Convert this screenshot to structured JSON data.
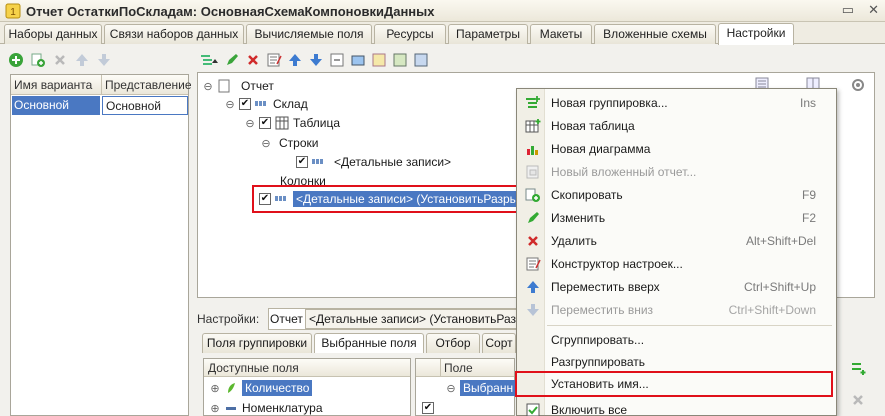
{
  "window": {
    "title": "Отчет ОстаткиПоСкладам: ОсновнаяСхемаКомпоновкиДанных"
  },
  "tabs": [
    {
      "label": "Наборы данных"
    },
    {
      "label": "Связи наборов данных"
    },
    {
      "label": "Вычисляемые поля"
    },
    {
      "label": "Ресурсы"
    },
    {
      "label": "Параметры"
    },
    {
      "label": "Макеты"
    },
    {
      "label": "Вложенные схемы"
    },
    {
      "label": "Настройки"
    }
  ],
  "variants": {
    "col_name": "Имя варианта",
    "col_repr": "Представление",
    "rows": [
      {
        "name": "Основной",
        "repr": "Основной"
      }
    ]
  },
  "tree": {
    "root": "Отчет",
    "sklad": "Склад",
    "table": "Таблица",
    "rows": "Строки",
    "detail_rows": "<Детальные записи>",
    "columns": "Колонки",
    "detail_cols": "<Детальные записи> (УстановитьРазрыв)"
  },
  "settings": {
    "label": "Настройки:",
    "crumb_root": "Отчет",
    "crumb_item": "<Детальные записи> (УстановитьРазрыв)"
  },
  "subtabs": [
    {
      "label": "Поля группировки"
    },
    {
      "label": "Выбранные поля"
    },
    {
      "label": "Отбор"
    },
    {
      "label": "Сорт"
    }
  ],
  "available": {
    "header": "Доступные поля",
    "items": [
      {
        "label": "Количество"
      },
      {
        "label": "Номенклатура"
      }
    ]
  },
  "selected": {
    "header": "Поле",
    "items": [
      {
        "label": "Выбранн"
      }
    ]
  },
  "context_menu": {
    "items": [
      {
        "label": "Новая группировка...",
        "key": "Ins",
        "icon": "new-grouping-icon"
      },
      {
        "label": "Новая таблица",
        "key": "",
        "icon": "new-table-icon"
      },
      {
        "label": "Новая диаграмма",
        "key": "",
        "icon": "new-chart-icon"
      },
      {
        "label": "Новый вложенный отчет...",
        "key": "",
        "icon": "new-nested-report-icon"
      },
      {
        "label": "Скопировать",
        "key": "F9",
        "icon": "copy-icon"
      },
      {
        "label": "Изменить",
        "key": "F2",
        "icon": "edit-icon"
      },
      {
        "label": "Удалить",
        "key": "Alt+Shift+Del",
        "icon": "delete-icon"
      },
      {
        "label": "Конструктор настроек...",
        "key": "",
        "icon": "settings-wizard-icon"
      },
      {
        "label": "Переместить вверх",
        "key": "Ctrl+Shift+Up",
        "icon": "move-up-icon"
      },
      {
        "label": "Переместить вниз",
        "key": "Ctrl+Shift+Down",
        "icon": "move-down-icon"
      },
      {
        "label": "Сгруппировать...",
        "key": "",
        "icon": ""
      },
      {
        "label": "Разгруппировать",
        "key": "",
        "icon": ""
      },
      {
        "label": "Установить имя...",
        "key": "",
        "icon": ""
      },
      {
        "label": "Включить все",
        "key": "",
        "icon": "enable-all-icon"
      }
    ]
  },
  "colors": {
    "accent": "#4a78c2",
    "highlight_box": "#e0101a"
  }
}
